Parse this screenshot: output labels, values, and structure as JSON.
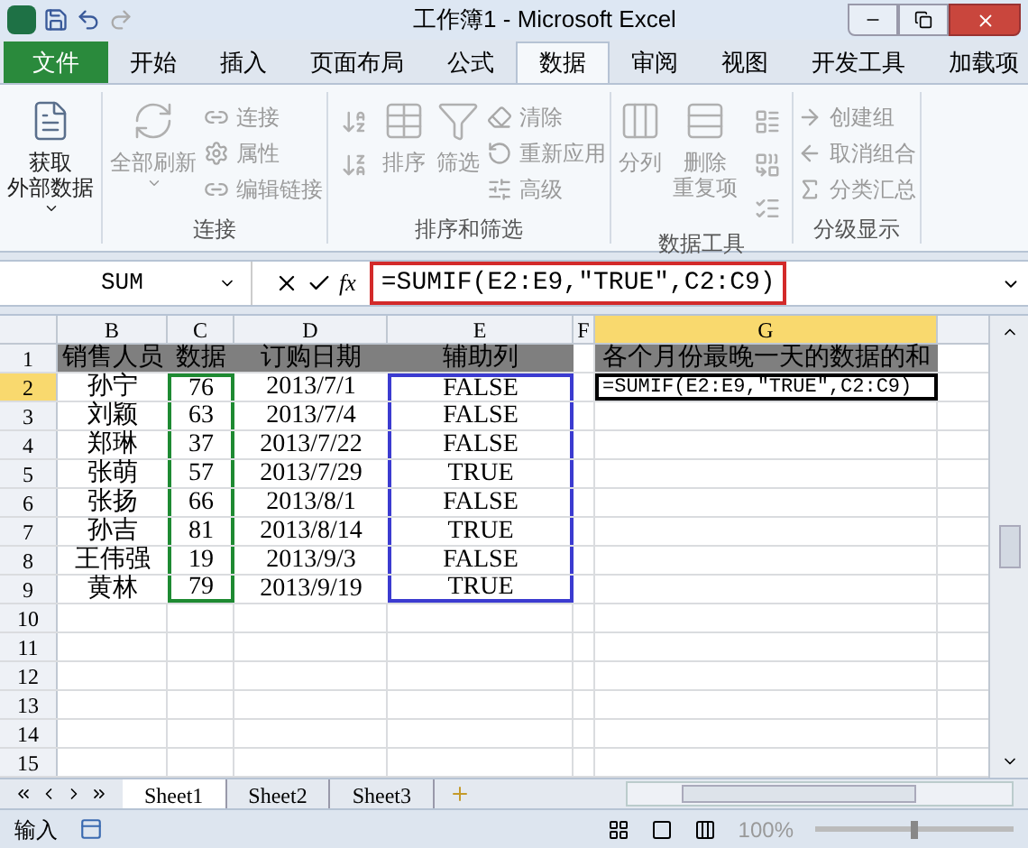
{
  "window": {
    "title": "工作簿1 - Microsoft Excel"
  },
  "ribbon_tabs": [
    {
      "label": "文件",
      "kind": "file",
      "selected": false
    },
    {
      "label": "开始",
      "kind": "tab",
      "selected": false
    },
    {
      "label": "插入",
      "kind": "tab",
      "selected": false
    },
    {
      "label": "页面布局",
      "kind": "tab",
      "selected": false
    },
    {
      "label": "公式",
      "kind": "tab",
      "selected": false
    },
    {
      "label": "数据",
      "kind": "tab",
      "selected": true
    },
    {
      "label": "审阅",
      "kind": "tab",
      "selected": false
    },
    {
      "label": "视图",
      "kind": "tab",
      "selected": false
    },
    {
      "label": "开发工具",
      "kind": "tab",
      "selected": false
    },
    {
      "label": "加载项",
      "kind": "tab",
      "selected": false
    }
  ],
  "ribbon_groups": [
    {
      "items": [
        {
          "kind": "large",
          "label_lines": [
            "获取",
            "外部数据"
          ],
          "dropdown": true,
          "disabled": false
        }
      ]
    },
    {
      "title": "连接",
      "items": [
        {
          "kind": "large",
          "label_lines": [
            "全部刷新"
          ],
          "dropdown": true,
          "disabled": true
        },
        {
          "kind": "small",
          "label": "连接",
          "disabled": true
        },
        {
          "kind": "small",
          "label": "属性",
          "disabled": true
        },
        {
          "kind": "small",
          "label": "编辑链接",
          "disabled": true
        }
      ]
    },
    {
      "title": "排序和筛选",
      "items": [
        {
          "kind": "icon",
          "disabled": true
        },
        {
          "kind": "icon",
          "disabled": true
        },
        {
          "kind": "large",
          "label_lines": [
            "排序"
          ],
          "disabled": true
        },
        {
          "kind": "large",
          "label_lines": [
            "筛选"
          ],
          "disabled": true
        },
        {
          "kind": "small",
          "label": "清除",
          "disabled": true
        },
        {
          "kind": "small",
          "label": "重新应用",
          "disabled": true
        },
        {
          "kind": "small",
          "label": "高级",
          "disabled": true
        }
      ]
    },
    {
      "title": "数据工具",
      "items": [
        {
          "kind": "large",
          "label_lines": [
            "分列"
          ],
          "disabled": true
        },
        {
          "kind": "large",
          "label_lines": [
            "删除",
            "重复项"
          ],
          "disabled": true
        },
        {
          "kind": "icon",
          "disabled": true
        },
        {
          "kind": "icon",
          "disabled": true
        },
        {
          "kind": "icon",
          "disabled": true
        }
      ]
    },
    {
      "title": "分级显示",
      "items": [
        {
          "kind": "small",
          "label": "创建组",
          "disabled": true
        },
        {
          "kind": "small",
          "label": "取消组合",
          "disabled": true
        },
        {
          "kind": "small",
          "label": "分类汇总",
          "disabled": true
        }
      ]
    }
  ],
  "formula_bar": {
    "name_box": "SUM",
    "function_label": "fx",
    "formula": "=SUMIF(E2:E9,\"TRUE\",C2:C9)"
  },
  "columns": [
    {
      "label": "B",
      "selected": false
    },
    {
      "label": "C",
      "selected": false
    },
    {
      "label": "D",
      "selected": false
    },
    {
      "label": "E",
      "selected": false
    },
    {
      "label": "F",
      "selected": false
    },
    {
      "label": "G",
      "selected": true
    }
  ],
  "rows": [
    {
      "header": "1",
      "selected": false,
      "cells": [
        {
          "text": "销售人员",
          "kind": "header"
        },
        {
          "text": "数据",
          "kind": "header"
        },
        {
          "text": "订购日期",
          "kind": "header"
        },
        {
          "text": "辅助列",
          "kind": "header"
        },
        {
          "text": "各个月份最晚一天的数据的和",
          "kind": "header"
        }
      ]
    },
    {
      "header": "2",
      "selected": true,
      "cells": [
        {
          "text": "孙宁"
        },
        {
          "text": "76",
          "color": "#1e8a32"
        },
        {
          "text": "2013/7/1"
        },
        {
          "text": "FALSE",
          "color": "#3b3bd0"
        },
        {
          "text": "=SUMIF(E2:E9,\"TRUE\",C2:C9)",
          "kind": "editing"
        }
      ]
    },
    {
      "header": "3",
      "selected": false,
      "cells": [
        {
          "text": "刘颖"
        },
        {
          "text": "63",
          "color": "#1e8a32"
        },
        {
          "text": "2013/7/4"
        },
        {
          "text": "FALSE",
          "color": "#3b3bd0"
        }
      ]
    },
    {
      "header": "4",
      "selected": false,
      "cells": [
        {
          "text": "郑琳"
        },
        {
          "text": "37",
          "color": "#1e8a32"
        },
        {
          "text": "2013/7/22"
        },
        {
          "text": "FALSE",
          "color": "#3b3bd0"
        }
      ]
    },
    {
      "header": "5",
      "selected": false,
      "cells": [
        {
          "text": "张萌"
        },
        {
          "text": "57",
          "color": "#1e8a32"
        },
        {
          "text": "2013/7/29"
        },
        {
          "text": "TRUE",
          "color": "#3b3bd0"
        }
      ]
    },
    {
      "header": "6",
      "selected": false,
      "cells": [
        {
          "text": "张扬"
        },
        {
          "text": "66",
          "color": "#1e8a32"
        },
        {
          "text": "2013/8/1"
        },
        {
          "text": "FALSE",
          "color": "#3b3bd0"
        }
      ]
    },
    {
      "header": "7",
      "selected": false,
      "cells": [
        {
          "text": "孙吉"
        },
        {
          "text": "81",
          "color": "#1e8a32"
        },
        {
          "text": "2013/8/14"
        },
        {
          "text": "TRUE",
          "color": "#3b3bd0"
        }
      ]
    },
    {
      "header": "8",
      "selected": false,
      "cells": [
        {
          "text": "王伟强"
        },
        {
          "text": "19",
          "color": "#1e8a32"
        },
        {
          "text": "2013/9/3"
        },
        {
          "text": "FALSE",
          "color": "#3b3bd0"
        }
      ]
    },
    {
      "header": "9",
      "selected": false,
      "cells": [
        {
          "text": "黄林"
        },
        {
          "text": "79",
          "color": "#1e8a32"
        },
        {
          "text": "2013/9/19"
        },
        {
          "text": "TRUE",
          "color": "#3b3bd0"
        }
      ]
    },
    {
      "header": "10",
      "selected": false,
      "cells": []
    },
    {
      "header": "11",
      "selected": false,
      "cells": []
    },
    {
      "header": "12",
      "selected": false,
      "cells": []
    },
    {
      "header": "13",
      "selected": false,
      "cells": []
    },
    {
      "header": "14",
      "selected": false,
      "cells": []
    },
    {
      "header": "15",
      "selected": false,
      "cells": []
    }
  ],
  "sheet_tabs": [
    {
      "label": "Sheet1",
      "selected": true
    },
    {
      "label": "Sheet2",
      "selected": false
    },
    {
      "label": "Sheet3",
      "selected": false
    }
  ],
  "status_bar": {
    "mode": "输入",
    "zoom": "100%",
    "zoom_slider": {
      "level": 0.5
    }
  }
}
